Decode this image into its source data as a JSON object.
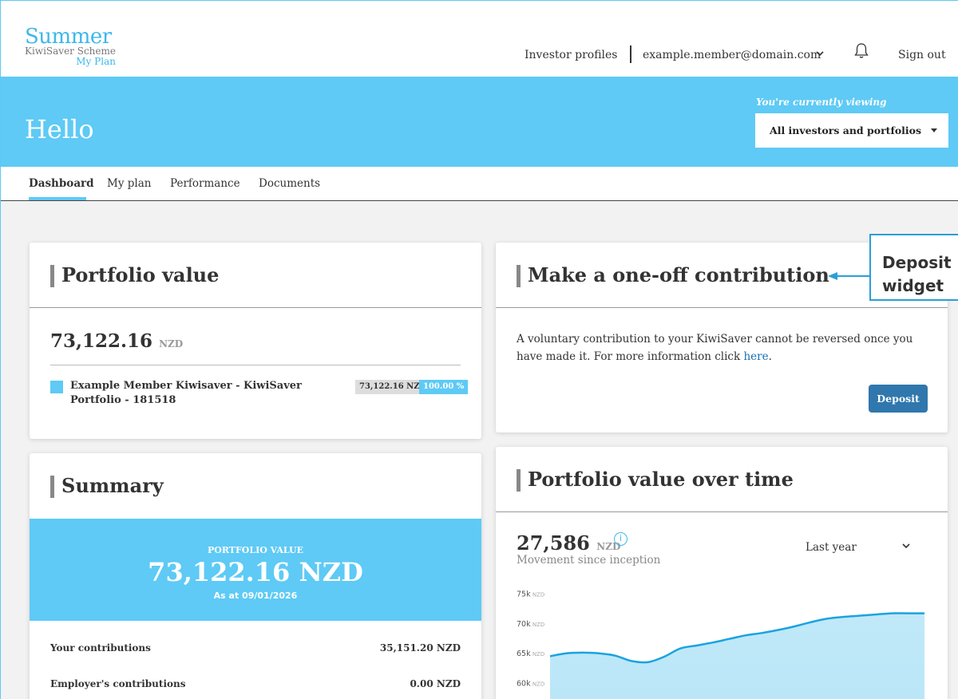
{
  "brand": {
    "name": "Summer",
    "sub": "KiwiSaver Scheme",
    "plan": "My Plan",
    "accent": "#5ecaf5"
  },
  "header": {
    "investor_profiles": "Investor profiles",
    "email": "example.member@domain.com",
    "sign_out": "Sign out"
  },
  "hero": {
    "greeting": "Hello",
    "viewing_label": "You're currently viewing",
    "viewing_value": "All investors and portfolios"
  },
  "tabs": [
    {
      "label": "Dashboard",
      "active": true
    },
    {
      "label": "My plan",
      "active": false
    },
    {
      "label": "Performance",
      "active": false
    },
    {
      "label": "Documents",
      "active": false
    }
  ],
  "portfolio_value": {
    "title": "Portfolio value",
    "amount": "73,122.16",
    "unit": "NZD",
    "holding_name": "Example Member Kiwisaver - KiwiSaver Portfolio - 181518",
    "holding_value": "73,122.16 NZD",
    "holding_percent": "100.00 %"
  },
  "contribution": {
    "title": "Make a one-off contribution",
    "text": "A voluntary contribution to your KiwiSaver cannot be reversed once you have made it. For more information click ",
    "link": "here",
    "text_end": ".",
    "button": "Deposit"
  },
  "callout": {
    "line1": "Deposit",
    "line2": "widget"
  },
  "summary": {
    "title": "Summary",
    "band_label": "PORTFOLIO VALUE",
    "band_value": "73,122.16 NZD",
    "band_asat": "As at 09/01/2026",
    "rows": [
      {
        "label": "Your contributions",
        "value": "35,151.20 NZD"
      },
      {
        "label": "Employer's contributions",
        "value": "0.00 NZD"
      }
    ]
  },
  "over_time": {
    "title": "Portfolio value over time",
    "amount": "27,586",
    "unit": "NZD",
    "info": "i",
    "subtitle": "Movement since inception",
    "period": "Last year"
  },
  "chart_data": {
    "type": "area",
    "y_tick_labels": [
      {
        "value": "75k",
        "unit": "NZD"
      },
      {
        "value": "70k",
        "unit": "NZD"
      },
      {
        "value": "65k",
        "unit": "NZD"
      },
      {
        "value": "60k",
        "unit": "NZD"
      }
    ],
    "ylim": [
      58200,
      75000
    ],
    "y_ticks": [
      75000,
      70000,
      65000,
      60000
    ],
    "values": [
      64500,
      65000,
      65100,
      65000,
      64600,
      63700,
      63500,
      64400,
      65800,
      66300,
      66800,
      67400,
      68000,
      68400,
      68900,
      69500,
      70200,
      70800,
      71100,
      71300,
      71500,
      71700,
      71700,
      71700
    ],
    "line_color": "#1aa3e0",
    "fill_color": "#b9e6f8",
    "grid": false
  }
}
